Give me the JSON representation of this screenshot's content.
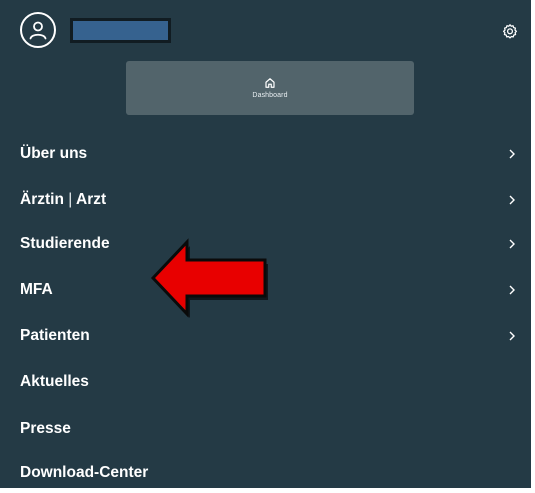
{
  "user": {
    "avatar_icon": "user-icon",
    "name_redacted_color": "#36628f"
  },
  "header": {
    "settings_icon": "gear-icon"
  },
  "dashboard": {
    "icon": "home-icon",
    "label": "Dashboard"
  },
  "menu": {
    "items": [
      {
        "label": "Über uns",
        "has_chevron": true
      },
      {
        "label_main": "Ärztin",
        "separator": "|",
        "label_second": "Arzt",
        "has_chevron": true
      },
      {
        "label": "Studierende",
        "has_chevron": true
      },
      {
        "label": "MFA",
        "has_chevron": true
      },
      {
        "label": "Patienten",
        "has_chevron": true
      },
      {
        "label": "Aktuelles",
        "has_chevron": false
      },
      {
        "label": "Presse",
        "has_chevron": false
      },
      {
        "label": "Download-Center",
        "has_chevron": false
      }
    ]
  },
  "annotation": {
    "icon": "red-arrow-icon",
    "color": "#e80000"
  },
  "colors": {
    "background": "#243a45",
    "button": "#52646b",
    "text": "#ffffff"
  }
}
